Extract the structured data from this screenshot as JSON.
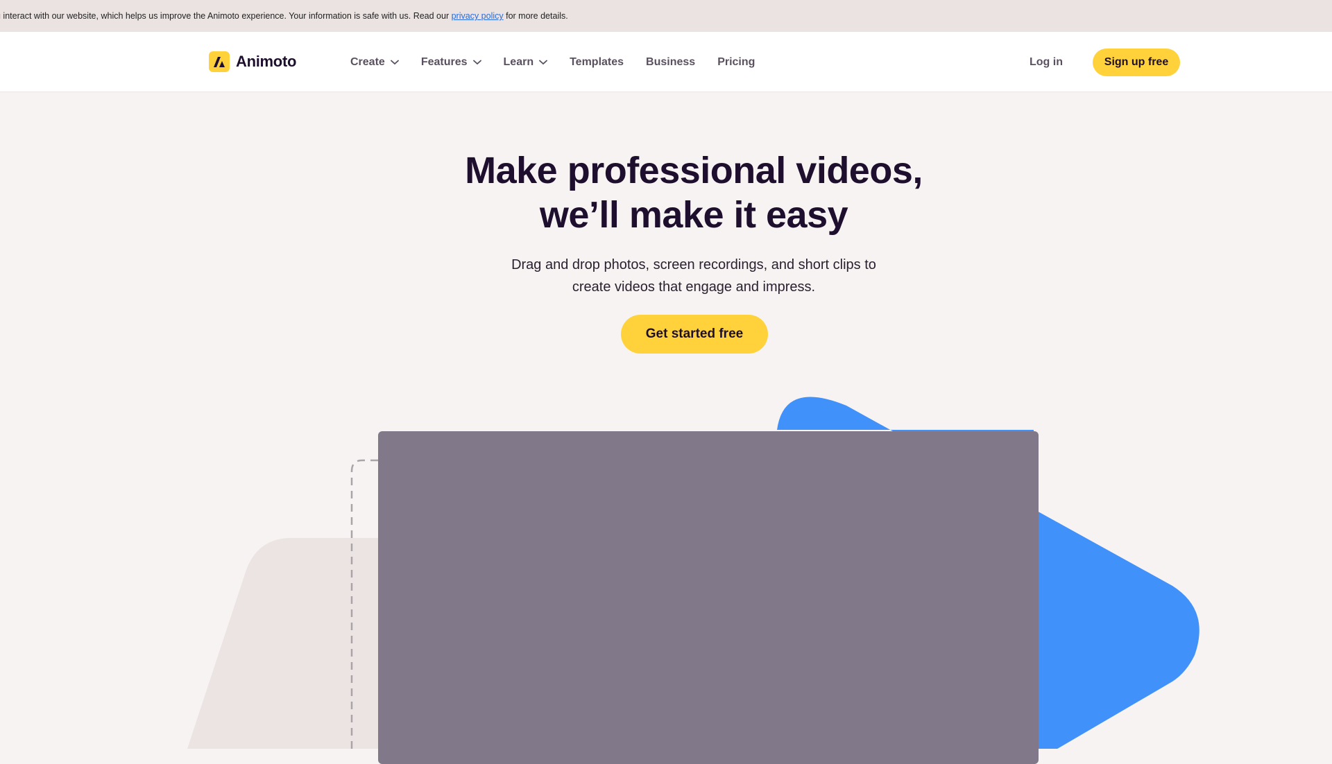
{
  "cookie_bar": {
    "text_before": "u interact with our website, which helps us improve the Animoto experience. Your information is safe with us. Read our ",
    "link_text": "privacy policy",
    "text_after": " for more details."
  },
  "nav": {
    "logo_text": "Animoto",
    "items": [
      {
        "label": "Create",
        "has_dropdown": true
      },
      {
        "label": "Features",
        "has_dropdown": true
      },
      {
        "label": "Learn",
        "has_dropdown": true
      },
      {
        "label": "Templates",
        "has_dropdown": false
      },
      {
        "label": "Business",
        "has_dropdown": false
      },
      {
        "label": "Pricing",
        "has_dropdown": false
      }
    ],
    "login_label": "Log in",
    "signup_label": "Sign up free"
  },
  "hero": {
    "title_line1": "Make professional videos,",
    "title_line2": "we’ll make it easy",
    "subtitle_line1": "Drag and drop photos, screen recordings, and short clips to",
    "subtitle_line2": "create videos that engage and impress.",
    "cta_label": "Get started free"
  },
  "colors": {
    "accent_yellow": "#ffd23c",
    "brand_blue": "#4191fb",
    "text_dark": "#1f0f2e",
    "video_panel": "#817989",
    "background": "#f6f3f2"
  },
  "icons": {
    "logo": "animoto-logo-icon",
    "dropdown": "chevron-down-icon"
  }
}
